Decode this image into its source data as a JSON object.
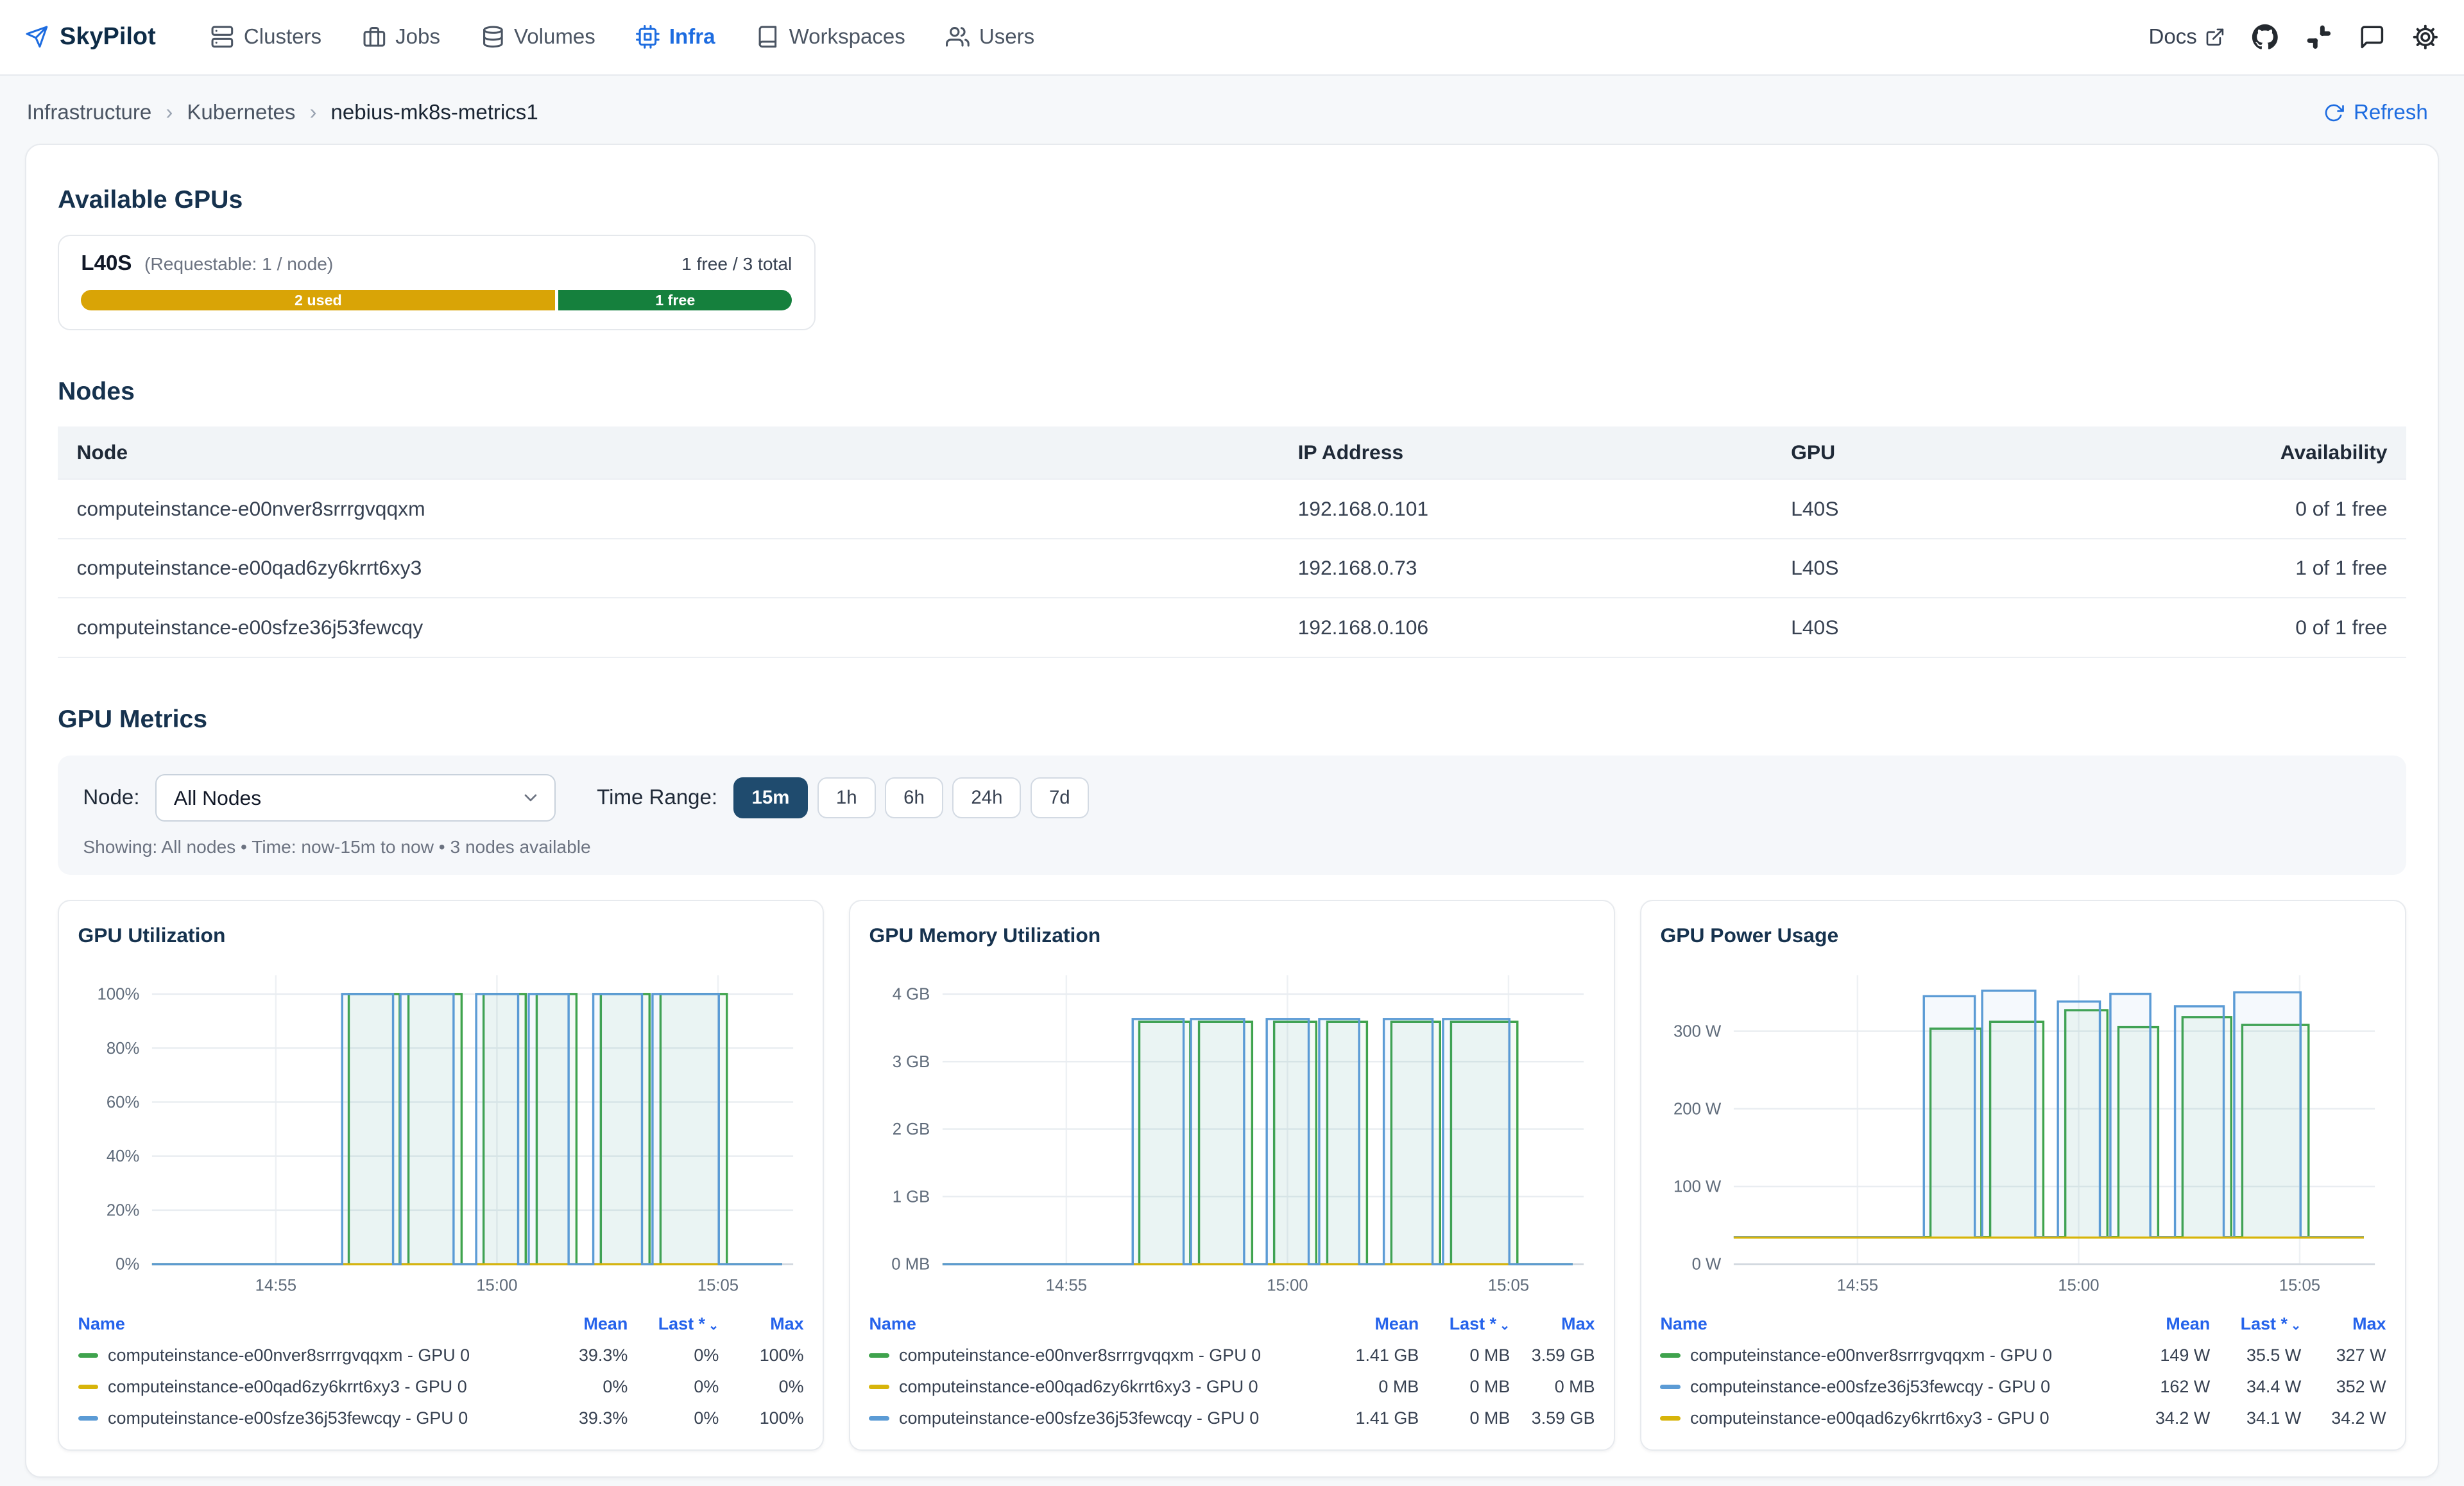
{
  "colors": {
    "accent": "#1d6ce0",
    "active_button": "#1f4b6e"
  },
  "navbar": {
    "brand": "SkyPilot",
    "items": [
      {
        "label": "Clusters",
        "icon": "clusters-icon",
        "active": false
      },
      {
        "label": "Jobs",
        "icon": "jobs-icon",
        "active": false
      },
      {
        "label": "Volumes",
        "icon": "volumes-icon",
        "active": false
      },
      {
        "label": "Infra",
        "icon": "infra-icon",
        "active": true
      },
      {
        "label": "Workspaces",
        "icon": "workspaces-icon",
        "active": false
      },
      {
        "label": "Users",
        "icon": "users-icon",
        "active": false
      }
    ],
    "docs_label": "Docs",
    "right_icons": [
      "external-link-icon",
      "github-icon",
      "slack-icon",
      "feedback-icon",
      "settings-icon"
    ]
  },
  "breadcrumb": {
    "items": [
      "Infrastructure",
      "Kubernetes",
      "nebius-mk8s-metrics1"
    ],
    "refresh_label": "Refresh"
  },
  "available_gpus": {
    "heading": "Available GPUs",
    "gpu": {
      "name": "L40S",
      "requestable": "(Requestable: 1 / node)",
      "summary": "1 free / 3 total",
      "bar": {
        "used_label": "2 used",
        "free_label": "1 free",
        "used_fraction": 0.667,
        "used_color": "#d9a406",
        "free_color": "#15803d"
      }
    }
  },
  "nodes": {
    "heading": "Nodes",
    "columns": [
      "Node",
      "IP Address",
      "GPU",
      "Availability"
    ],
    "rows": [
      {
        "node": "computeinstance-e00nver8srrrgvqqxm",
        "ip": "192.168.0.101",
        "gpu": "L40S",
        "availability": "0 of 1 free"
      },
      {
        "node": "computeinstance-e00qad6zy6krrt6xy3",
        "ip": "192.168.0.73",
        "gpu": "L40S",
        "availability": "1 of 1 free"
      },
      {
        "node": "computeinstance-e00sfze36j53fewcqy",
        "ip": "192.168.0.106",
        "gpu": "L40S",
        "availability": "0 of 1 free"
      }
    ]
  },
  "metrics": {
    "heading": "GPU Metrics",
    "node_label": "Node:",
    "node_selected": "All Nodes",
    "time_range_label": "Time Range:",
    "time_ranges": [
      {
        "label": "15m",
        "active": true
      },
      {
        "label": "1h",
        "active": false
      },
      {
        "label": "6h",
        "active": false
      },
      {
        "label": "24h",
        "active": false
      },
      {
        "label": "7d",
        "active": false
      }
    ],
    "showing": "Showing: All nodes • Time: now-15m to now • 3 nodes available"
  },
  "chart_data": [
    {
      "type": "line",
      "title": "GPU Utilization",
      "xlim": [
        0,
        14.5
      ],
      "ylim": [
        0,
        107
      ],
      "x_end": 14.25,
      "xticks": [
        {
          "v": 2.8,
          "label": "14:55"
        },
        {
          "v": 7.8,
          "label": "15:00"
        },
        {
          "v": 12.8,
          "label": "15:05"
        }
      ],
      "yticks": [
        {
          "v": 0,
          "label": "0%"
        },
        {
          "v": 20,
          "label": "20%"
        },
        {
          "v": 40,
          "label": "40%"
        },
        {
          "v": 60,
          "label": "60%"
        },
        {
          "v": 80,
          "label": "80%"
        },
        {
          "v": 100,
          "label": "100%"
        }
      ],
      "legend_headers": [
        "Name",
        "Mean",
        "Last *",
        "Max"
      ],
      "series": [
        {
          "name": "computeinstance-e00nver8srrrgvqqxm - GPU 0",
          "color": "#3fa34d",
          "base": 0,
          "high": 100,
          "pulses": [
            [
              4.45,
              5.6
            ],
            [
              5.8,
              7.0
            ],
            [
              7.5,
              8.45
            ],
            [
              8.7,
              9.6
            ],
            [
              10.15,
              11.25
            ],
            [
              11.5,
              13.0
            ]
          ],
          "mean": "39.3%",
          "last": "0%",
          "max": "100%"
        },
        {
          "name": "computeinstance-e00qad6zy6krrt6xy3 - GPU 0",
          "color": "#d7b40a",
          "flat": 0,
          "mean": "0%",
          "last": "0%",
          "max": "0%"
        },
        {
          "name": "computeinstance-e00sfze36j53fewcqy - GPU 0",
          "color": "#5b9bd5",
          "base": 0,
          "high": 100,
          "pulses": [
            [
              4.3,
              5.45
            ],
            [
              5.62,
              6.82
            ],
            [
              7.33,
              8.28
            ],
            [
              8.52,
              9.42
            ],
            [
              9.98,
              11.08
            ],
            [
              11.32,
              12.82
            ]
          ],
          "mean": "39.3%",
          "last": "0%",
          "max": "100%"
        }
      ]
    },
    {
      "type": "line",
      "title": "GPU Memory Utilization",
      "xlim": [
        0,
        14.5
      ],
      "ylim": [
        0,
        4.28
      ],
      "x_end": 14.25,
      "xticks": [
        {
          "v": 2.8,
          "label": "14:55"
        },
        {
          "v": 7.8,
          "label": "15:00"
        },
        {
          "v": 12.8,
          "label": "15:05"
        }
      ],
      "yticks": [
        {
          "v": 0,
          "label": "0 MB"
        },
        {
          "v": 1,
          "label": "1 GB"
        },
        {
          "v": 2,
          "label": "2 GB"
        },
        {
          "v": 3,
          "label": "3 GB"
        },
        {
          "v": 4,
          "label": "4 GB"
        }
      ],
      "legend_headers": [
        "Name",
        "Mean",
        "Last *",
        "Max"
      ],
      "series": [
        {
          "name": "computeinstance-e00nver8srrrgvqqxm - GPU 0",
          "color": "#3fa34d",
          "base": 0,
          "high": 3.59,
          "pulses": [
            [
              4.45,
              5.6
            ],
            [
              5.8,
              7.0
            ],
            [
              7.5,
              8.45
            ],
            [
              8.7,
              9.6
            ],
            [
              10.15,
              11.25
            ],
            [
              11.5,
              13.0
            ]
          ],
          "mean": "1.41 GB",
          "last": "0 MB",
          "max": "3.59 GB"
        },
        {
          "name": "computeinstance-e00qad6zy6krrt6xy3 - GPU 0",
          "color": "#d7b40a",
          "flat": 0,
          "mean": "0 MB",
          "last": "0 MB",
          "max": "0 MB"
        },
        {
          "name": "computeinstance-e00sfze36j53fewcqy - GPU 0",
          "color": "#5b9bd5",
          "base": 0,
          "high": 3.63,
          "pulses": [
            [
              4.3,
              5.45
            ],
            [
              5.62,
              6.82
            ],
            [
              7.33,
              8.28
            ],
            [
              8.52,
              9.42
            ],
            [
              9.98,
              11.08
            ],
            [
              11.32,
              12.82
            ]
          ],
          "mean": "1.41 GB",
          "last": "0 MB",
          "max": "3.59 GB"
        }
      ]
    },
    {
      "type": "line",
      "title": "GPU Power Usage",
      "xlim": [
        0,
        14.5
      ],
      "ylim": [
        0,
        372
      ],
      "x_end": 14.25,
      "xticks": [
        {
          "v": 2.8,
          "label": "14:55"
        },
        {
          "v": 7.8,
          "label": "15:00"
        },
        {
          "v": 12.8,
          "label": "15:05"
        }
      ],
      "yticks": [
        {
          "v": 0,
          "label": "0 W"
        },
        {
          "v": 100,
          "label": "100 W"
        },
        {
          "v": 200,
          "label": "200 W"
        },
        {
          "v": 300,
          "label": "300 W"
        }
      ],
      "legend_headers": [
        "Name",
        "Mean",
        "Last *",
        "Max"
      ],
      "series": [
        {
          "name": "computeinstance-e00nver8srrrgvqqxm - GPU 0",
          "color": "#3fa34d",
          "base": 35,
          "high": [
            303,
            312,
            327,
            305,
            318,
            308
          ],
          "pulses": [
            [
              4.45,
              5.6
            ],
            [
              5.8,
              7.0
            ],
            [
              7.5,
              8.45
            ],
            [
              8.7,
              9.6
            ],
            [
              10.15,
              11.25
            ],
            [
              11.5,
              13.0
            ]
          ],
          "mean": "149 W",
          "last": "35.5 W",
          "max": "327 W"
        },
        {
          "name": "computeinstance-e00sfze36j53fewcqy - GPU 0",
          "color": "#5b9bd5",
          "base": 35,
          "high": [
            345,
            352,
            338,
            348,
            332,
            350
          ],
          "pulses": [
            [
              4.3,
              5.45
            ],
            [
              5.62,
              6.82
            ],
            [
              7.33,
              8.28
            ],
            [
              8.52,
              9.42
            ],
            [
              9.98,
              11.08
            ],
            [
              11.32,
              12.82
            ]
          ],
          "mean": "162 W",
          "last": "34.4 W",
          "max": "352 W"
        },
        {
          "name": "computeinstance-e00qad6zy6krrt6xy3 - GPU 0",
          "color": "#d7b40a",
          "flat": 34.2,
          "mean": "34.2 W",
          "last": "34.1 W",
          "max": "34.2 W"
        }
      ]
    }
  ]
}
